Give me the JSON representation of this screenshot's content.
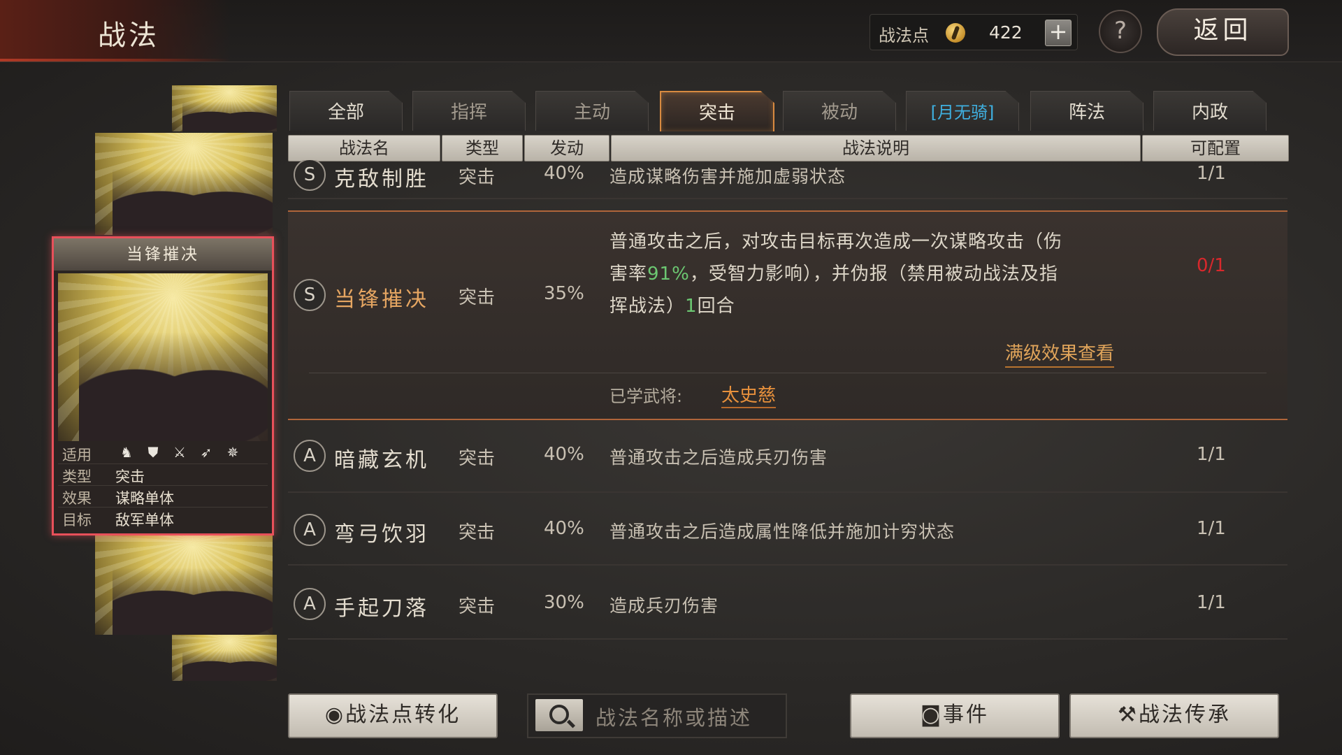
{
  "header": {
    "title": "战法",
    "points_label": "战法点",
    "points_value": "422",
    "add_symbol": "+",
    "help_symbol": "?",
    "back_label": "返回"
  },
  "tabs": [
    {
      "label": "全部"
    },
    {
      "label": "指挥"
    },
    {
      "label": "主动"
    },
    {
      "label": "突击"
    },
    {
      "label": "被动"
    },
    {
      "label": "[月无骑]"
    },
    {
      "label": "阵法"
    },
    {
      "label": "内政"
    }
  ],
  "columns": {
    "name": "战法名",
    "type": "类型",
    "trigger": "发动",
    "description": "战法说明",
    "configurable": "可配置"
  },
  "selected_card": {
    "title": "当锋摧决",
    "applicable_label": "适用",
    "type_label": "类型",
    "type_value": "突击",
    "effect_label": "效果",
    "effect_value": "谋略单体",
    "target_label": "目标",
    "target_value": "敌军单体",
    "unit_icons": [
      "cavalry-icon",
      "shield-icon",
      "crossed-swords-icon",
      "bow-icon",
      "chariot-wheel-icon"
    ]
  },
  "tactics": [
    {
      "grade": "S",
      "name": "克敌制胜",
      "type": "突击",
      "rate": "40%",
      "desc": "造成谋略伤害并施加虚弱状态",
      "count": "1/1"
    },
    {
      "grade": "S",
      "name": "当锋摧决",
      "type": "突击",
      "rate": "35%",
      "desc_line1": "普通攻击之后，对攻击目标再次造成一次谋略攻击（伤",
      "desc_line2_pre": "害率",
      "desc_line2_green": "91%",
      "desc_line2_post": "，受智力影响），并伪报（禁用被动战法及指",
      "desc_line3_pre": "挥战法）",
      "desc_line3_green": "1",
      "desc_line3_post": "回合",
      "count": "0/1",
      "full_effect_link": "满级效果查看",
      "learned_label": "已学武将:",
      "learned_name": "太史慈"
    },
    {
      "grade": "A",
      "name": "暗藏玄机",
      "type": "突击",
      "rate": "40%",
      "desc": "普通攻击之后造成兵刃伤害",
      "count": "1/1"
    },
    {
      "grade": "A",
      "name": "弯弓饮羽",
      "type": "突击",
      "rate": "40%",
      "desc": "普通攻击之后造成属性降低并施加计穷状态",
      "count": "1/1"
    },
    {
      "grade": "A",
      "name": "手起刀落",
      "type": "突击",
      "rate": "30%",
      "desc": "造成兵刃伤害",
      "count": "1/1"
    }
  ],
  "bottom": {
    "convert_label": "战法点转化",
    "search_placeholder": "战法名称或描述",
    "events_label": "事件",
    "inherit_label": "战法传承"
  },
  "colors": {
    "active_tab_border": "#d88a40",
    "selection_border": "#e8505a",
    "highlight_name": "#e6a662",
    "unavailable_count": "#d8282c",
    "green_value": "#6cc872",
    "filter_tab_text": "#3fb0e0"
  }
}
